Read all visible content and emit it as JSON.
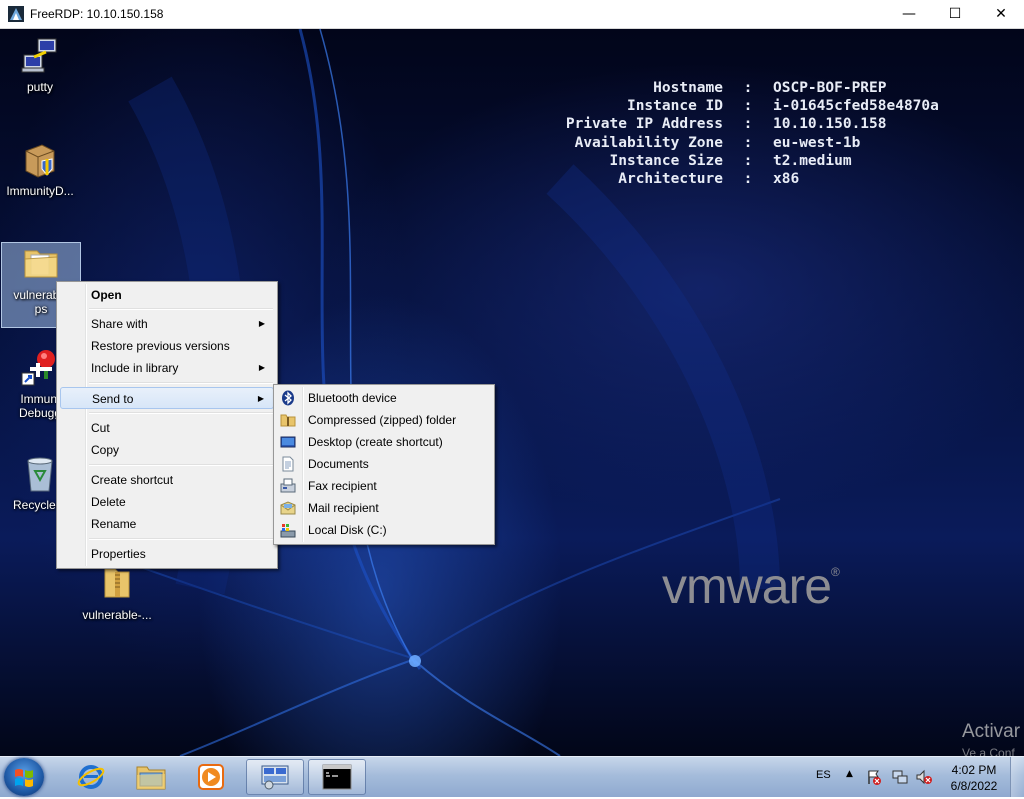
{
  "window": {
    "title": "FreeRDP: 10.10.150.158",
    "minimize_glyph": "—",
    "maximize_glyph": "☐",
    "close_glyph": "✕"
  },
  "sysinfo": [
    {
      "key": "Hostname",
      "sep": ":",
      "value": "OSCP-BOF-PREP"
    },
    {
      "key": "Instance ID",
      "sep": ":",
      "value": "i-01645cfed58e4870a"
    },
    {
      "key": "Private IP Address",
      "sep": ":",
      "value": "10.10.150.158"
    },
    {
      "key": "Availability Zone",
      "sep": ":",
      "value": "eu-west-1b"
    },
    {
      "key": "Instance Size",
      "sep": ":",
      "value": "t2.medium"
    },
    {
      "key": "Architecture",
      "sep": ":",
      "value": "x86"
    }
  ],
  "branding": {
    "logo_text": "vmware",
    "reg": "®"
  },
  "watermark": {
    "line1": "Activar",
    "line2": "Ve a Conf"
  },
  "desktop_icons": [
    {
      "label": "putty",
      "icon": "network-computer-icon"
    },
    {
      "label": "ImmunityD...",
      "icon": "installer-box-icon"
    },
    {
      "label": "vulnerable-apps",
      "line1": "vulnerable",
      "line2": "ps",
      "icon": "folder-icon"
    },
    {
      "label": "Immunity Debugger",
      "line1": "Immuni",
      "line2": "Debugg",
      "icon": "debugger-shortcut-icon"
    },
    {
      "label": "Recycle Bin",
      "line1": "Recycle B",
      "icon": "recycle-bin-icon"
    },
    {
      "label": "vulnerable-...",
      "icon": "zip-folder-icon"
    }
  ],
  "context_menu": {
    "items": [
      {
        "label": "Open",
        "bold": true
      },
      {
        "label": "Share with",
        "submenu": true
      },
      {
        "label": "Restore previous versions"
      },
      {
        "label": "Include in library",
        "submenu": true
      },
      {
        "label": "Send to",
        "submenu": true,
        "highlighted": true
      },
      {
        "label": "Cut"
      },
      {
        "label": "Copy"
      },
      {
        "label": "Create shortcut"
      },
      {
        "label": "Delete"
      },
      {
        "label": "Rename"
      },
      {
        "label": "Properties"
      }
    ],
    "arrow": "▶"
  },
  "send_to_menu": {
    "items": [
      {
        "label": "Bluetooth device",
        "icon": "bluetooth-icon"
      },
      {
        "label": "Compressed (zipped) folder",
        "icon": "zip-folder-icon"
      },
      {
        "label": "Desktop (create shortcut)",
        "icon": "desktop-icon"
      },
      {
        "label": "Documents",
        "icon": "document-icon"
      },
      {
        "label": "Fax recipient",
        "icon": "fax-icon"
      },
      {
        "label": "Mail recipient",
        "icon": "mail-icon"
      },
      {
        "label": "Local Disk (C:)",
        "icon": "hard-disk-icon"
      }
    ]
  },
  "taskbar": {
    "pinned": [
      {
        "name": "internet-explorer",
        "icon": "internet-explorer-icon"
      },
      {
        "name": "windows-explorer",
        "icon": "folder-icon"
      },
      {
        "name": "media-player",
        "icon": "media-player-icon"
      },
      {
        "name": "server-manager",
        "icon": "server-manager-icon",
        "active": true
      },
      {
        "name": "command-prompt",
        "icon": "cmd-icon",
        "active": true
      }
    ],
    "tray": {
      "language": "ES",
      "show_hidden_glyph": "▲",
      "icons": [
        "action-center-icon",
        "network-icon",
        "volume-muted-icon"
      ]
    },
    "clock": {
      "time": "4:02 PM",
      "date": "6/8/2022"
    }
  },
  "colors": {
    "desktop_dark": "#02051a",
    "desktop_blue": "#0a1b5a",
    "menu_bg": "#f0f0f0",
    "menu_highlight": "#d7e6f8",
    "taskbar": "#a5bcdb"
  }
}
